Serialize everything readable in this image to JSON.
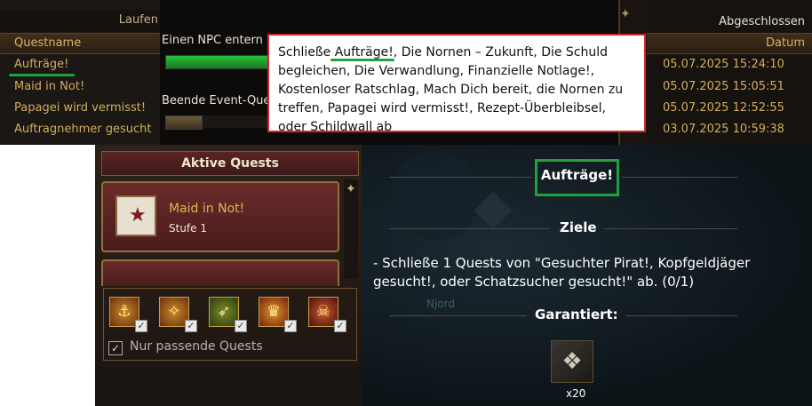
{
  "left_panel": {
    "header": "Laufen",
    "column": "Questname",
    "items": [
      "Aufträge!",
      "Maid in Not!",
      "Papagei wird vermisst!",
      "Auftragnehmer gesucht"
    ]
  },
  "middle_panel": {
    "label1": "Einen NPC entern",
    "label2": "Beende Event-Ques"
  },
  "right_panel": {
    "header": "Abgeschlossen",
    "column": "Datum",
    "dates": [
      "05.07.2025 15:24:10",
      "05.07.2025 15:05:51",
      "05.07.2025 12:52:55",
      "03.07.2025 10:59:38"
    ]
  },
  "tooltip": {
    "lines": [
      "Schließe Aufträge!, Die Nornen – Zukunft, Die Schuld",
      "begleichen, Die Verwandlung, Finanzielle Notlage!,",
      "Kostenloser Ratschlag, Mach Dich bereit, die Nornen zu",
      "treffen, Papagei wird vermisst!, Rezept-Überbleibsel,",
      "oder Schildwall ab"
    ]
  },
  "quest_list": {
    "header": "Aktive Quests",
    "selected": {
      "name": "Maid in Not!",
      "level": "Stufe 1"
    },
    "filter_label": "Nur passende Quests"
  },
  "quest_detail": {
    "title": "Aufträge!",
    "objectives_heading": "Ziele",
    "objective": "- Schließe 1 Quests von \"Gesuchter Pirat!, Kopfgeldjäger gesucht!, oder Schatzsucher gesucht!\" ab. (0/1)",
    "map_label": "Njord",
    "rewards_heading": "Garantiert:",
    "reward_count": "x20"
  },
  "colors": {
    "highlight_green": "#1fa140",
    "tooltip_border": "#d8232a",
    "gold_text": "#d3ad5d"
  }
}
